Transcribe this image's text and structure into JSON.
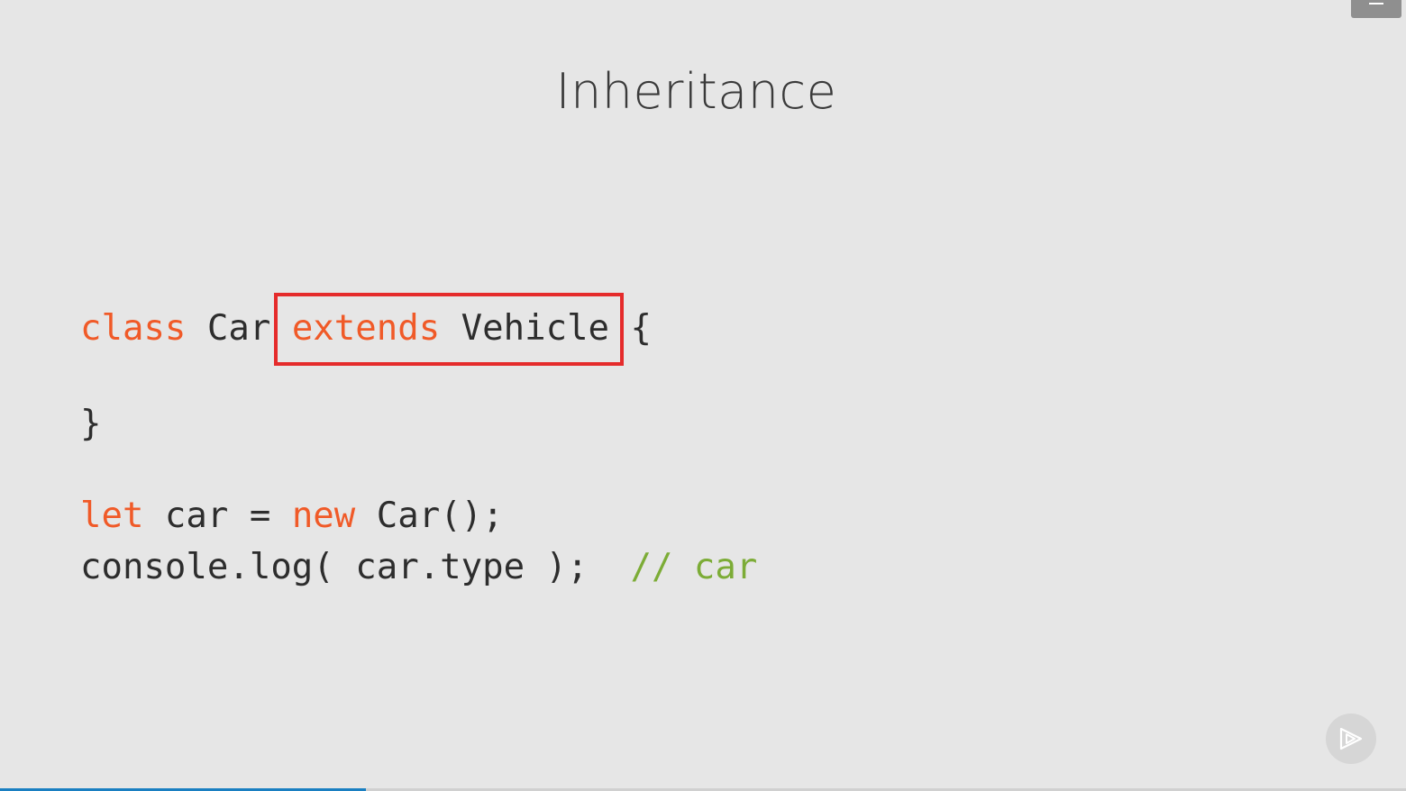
{
  "slide": {
    "title": "Inheritance"
  },
  "code": {
    "line1": {
      "kw_class": "class",
      "car": " Car ",
      "kw_extends": "extends",
      "vehicle": " Vehicle ",
      "brace": "{"
    },
    "line2": "}",
    "line3": {
      "kw_let": "let",
      "mid": " car = ",
      "kw_new": "new",
      "rest": " Car();"
    },
    "line4": {
      "code": "console.log( car.type );  ",
      "comment": "// car"
    }
  },
  "icons": {
    "menu": "menu-icon",
    "logo": "play-logo-icon"
  },
  "colors": {
    "background": "#e6e6e6",
    "keyword": "#f05a28",
    "comment": "#7cac36",
    "text": "#2d2d2d",
    "highlight": "#e52b2b",
    "progress": "#1a7fc1"
  },
  "progress": {
    "fraction": 0.26
  }
}
